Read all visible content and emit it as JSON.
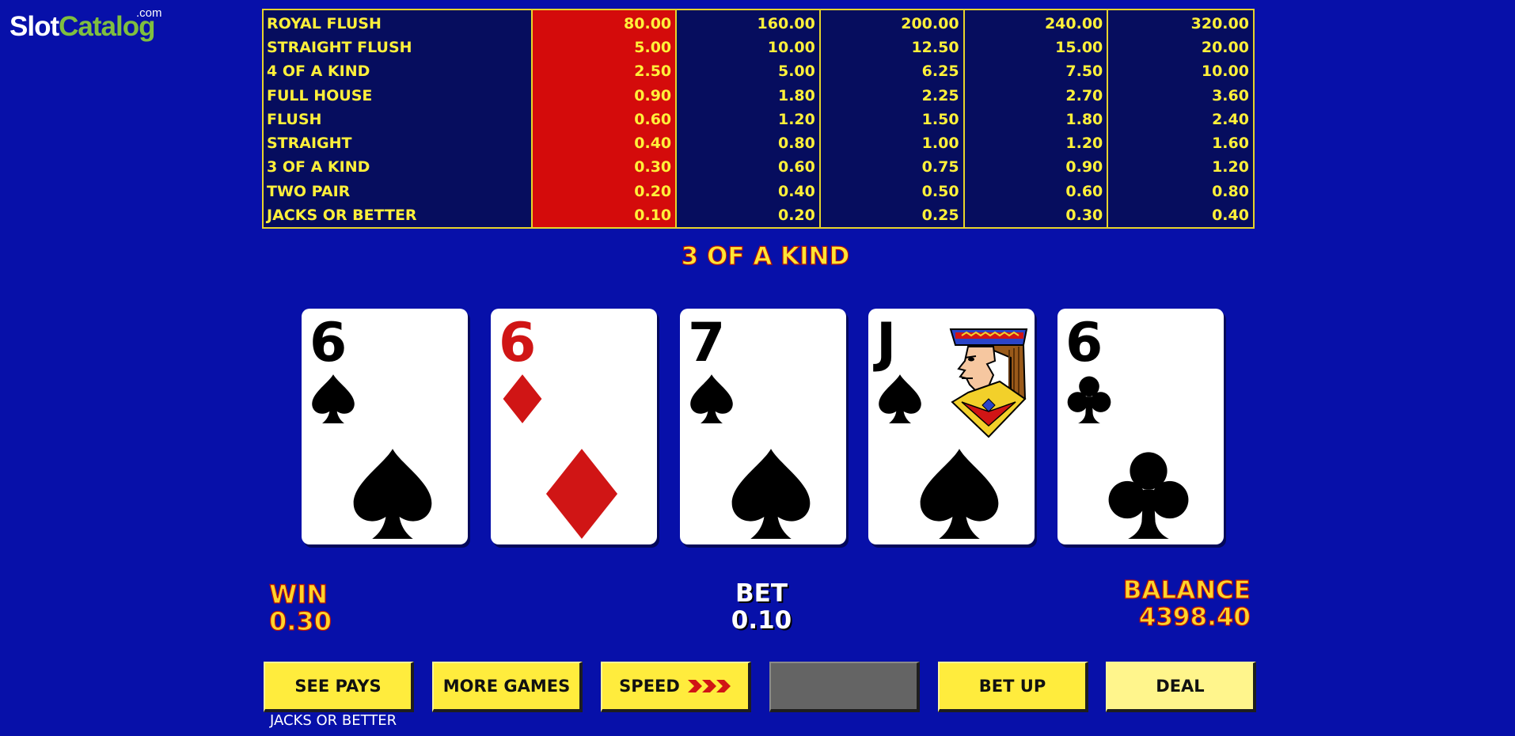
{
  "logo": {
    "slot": "Slot",
    "catalog": "Catalog",
    "com": ".com"
  },
  "paytable": {
    "hands": [
      "ROYAL FLUSH",
      "STRAIGHT FLUSH",
      "4 OF A KIND",
      "FULL HOUSE",
      "FLUSH",
      "STRAIGHT",
      "3 OF A KIND",
      "TWO PAIR",
      "JACKS OR BETTER"
    ],
    "columns": [
      [
        "80.00",
        "5.00",
        "2.50",
        "0.90",
        "0.60",
        "0.40",
        "0.30",
        "0.20",
        "0.10"
      ],
      [
        "160.00",
        "10.00",
        "5.00",
        "1.80",
        "1.20",
        "0.80",
        "0.60",
        "0.40",
        "0.20"
      ],
      [
        "200.00",
        "12.50",
        "6.25",
        "2.25",
        "1.50",
        "1.00",
        "0.75",
        "0.50",
        "0.25"
      ],
      [
        "240.00",
        "15.00",
        "7.50",
        "2.70",
        "1.80",
        "1.20",
        "0.90",
        "0.60",
        "0.30"
      ],
      [
        "320.00",
        "20.00",
        "10.00",
        "3.60",
        "2.40",
        "1.60",
        "1.20",
        "0.80",
        "0.40"
      ]
    ],
    "active_column": 1,
    "highlight_color": "#d40b0b",
    "border_color": "#e7d42a",
    "text_color": "#fff03a"
  },
  "status": "3 OF A KIND",
  "cards": [
    {
      "rank": "6",
      "suit": "spade-icon",
      "color": "black"
    },
    {
      "rank": "6",
      "suit": "diamond-icon",
      "color": "red"
    },
    {
      "rank": "7",
      "suit": "spade-icon",
      "color": "black"
    },
    {
      "rank": "J",
      "suit": "spade-icon",
      "color": "black",
      "face": "jack-portrait-icon"
    },
    {
      "rank": "6",
      "suit": "club-icon",
      "color": "black"
    }
  ],
  "win": {
    "label": "WIN",
    "value": "0.30"
  },
  "bet": {
    "label": "BET",
    "value": "0.10"
  },
  "balance": {
    "label": "BALANCE",
    "value": "4398.40"
  },
  "buttons": {
    "see_pays": "SEE PAYS",
    "more_games": "MORE GAMES",
    "speed": "SPEED",
    "blank": "",
    "bet_up": "BET UP",
    "deal": "DEAL"
  },
  "game_name": "JACKS OR BETTER",
  "colors": {
    "background": "#0710a9",
    "button": "#ffec3d",
    "button_disabled": "#646464"
  }
}
